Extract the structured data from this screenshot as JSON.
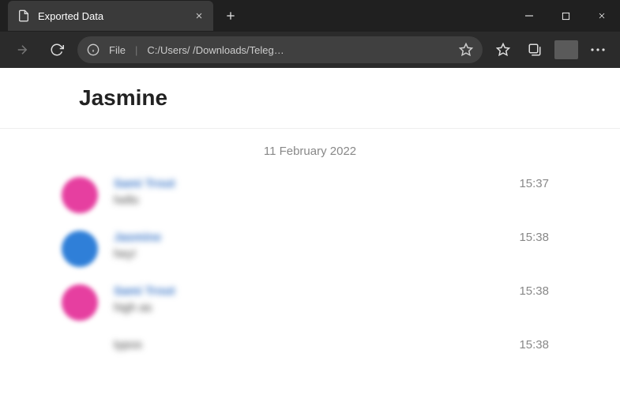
{
  "browser": {
    "tab_title": "Exported Data",
    "address_scheme": "File",
    "address_path": "C:/Users/      /Downloads/Teleg…"
  },
  "chat": {
    "title": "Jasmine",
    "date_divider": "11 February 2022",
    "messages": [
      {
        "sender": "Sami Trout",
        "text": "hello",
        "time": "15:37",
        "avatar": "pink"
      },
      {
        "sender": "Jasmine",
        "text": "hey!",
        "time": "15:38",
        "avatar": "blue"
      },
      {
        "sender": "Sami Trout",
        "text": "high as",
        "time": "15:38",
        "avatar": "pink"
      },
      {
        "sender": "",
        "text": "typos",
        "time": "15:38",
        "avatar": "none"
      }
    ]
  }
}
